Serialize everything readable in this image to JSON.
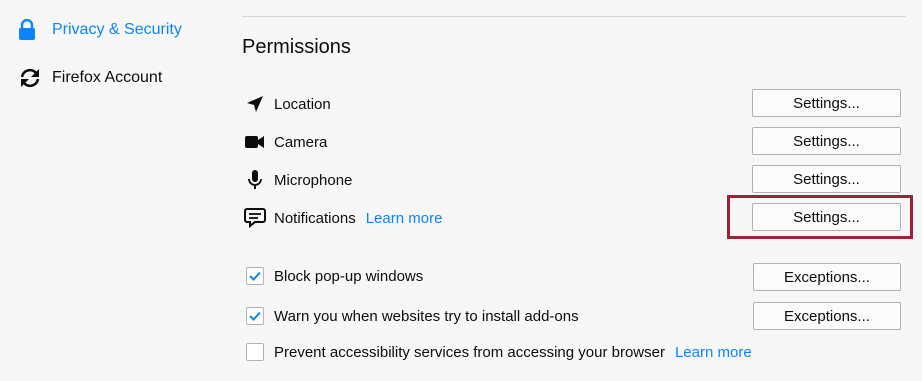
{
  "sidebar": {
    "items": [
      {
        "label": "Privacy & Security",
        "icon": "lock-icon",
        "active": true
      },
      {
        "label": "Firefox Account",
        "icon": "sync-icon",
        "active": false
      }
    ]
  },
  "permissions": {
    "title": "Permissions",
    "rows": [
      {
        "label": "Location",
        "icon": "location-arrow-icon",
        "button": "Settings..."
      },
      {
        "label": "Camera",
        "icon": "camera-icon",
        "button": "Settings..."
      },
      {
        "label": "Microphone",
        "icon": "microphone-icon",
        "button": "Settings..."
      },
      {
        "label": "Notifications",
        "icon": "notification-bubble-icon",
        "learn_more": "Learn more",
        "button": "Settings..."
      }
    ],
    "checkboxes": [
      {
        "label": "Block pop-up windows",
        "checked": true,
        "button": "Exceptions..."
      },
      {
        "label": "Warn you when websites try to install add-ons",
        "checked": true,
        "button": "Exceptions..."
      },
      {
        "label": "Prevent accessibility services from accessing your browser",
        "checked": false,
        "learn_more": "Learn more"
      }
    ]
  },
  "colors": {
    "accent": "#0a84ff",
    "highlight": "#9b2335",
    "background": "#f7f7f7"
  }
}
